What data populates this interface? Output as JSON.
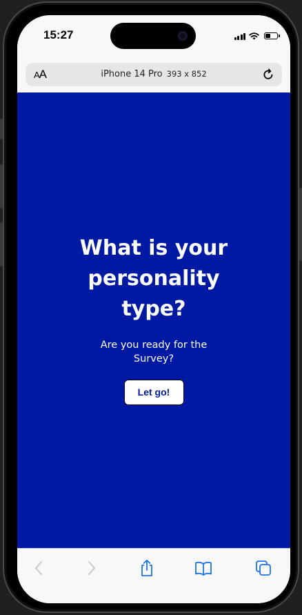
{
  "status_bar": {
    "time": "15:27",
    "battery_level_percent": 45
  },
  "browser": {
    "text_size_label_small": "A",
    "text_size_label_large": "A",
    "device_name": "iPhone 14 Pro",
    "viewport": "393 x 852"
  },
  "page": {
    "headline": "What is your personality type?",
    "subtext": "Are you ready for the Survey?",
    "cta_label": "Let go!",
    "background_color": "#0019a3"
  },
  "toolbar": {
    "icons": [
      "back-icon",
      "forward-icon",
      "share-icon",
      "bookmarks-icon",
      "tabs-icon"
    ],
    "accent_color": "#1a73e8"
  }
}
